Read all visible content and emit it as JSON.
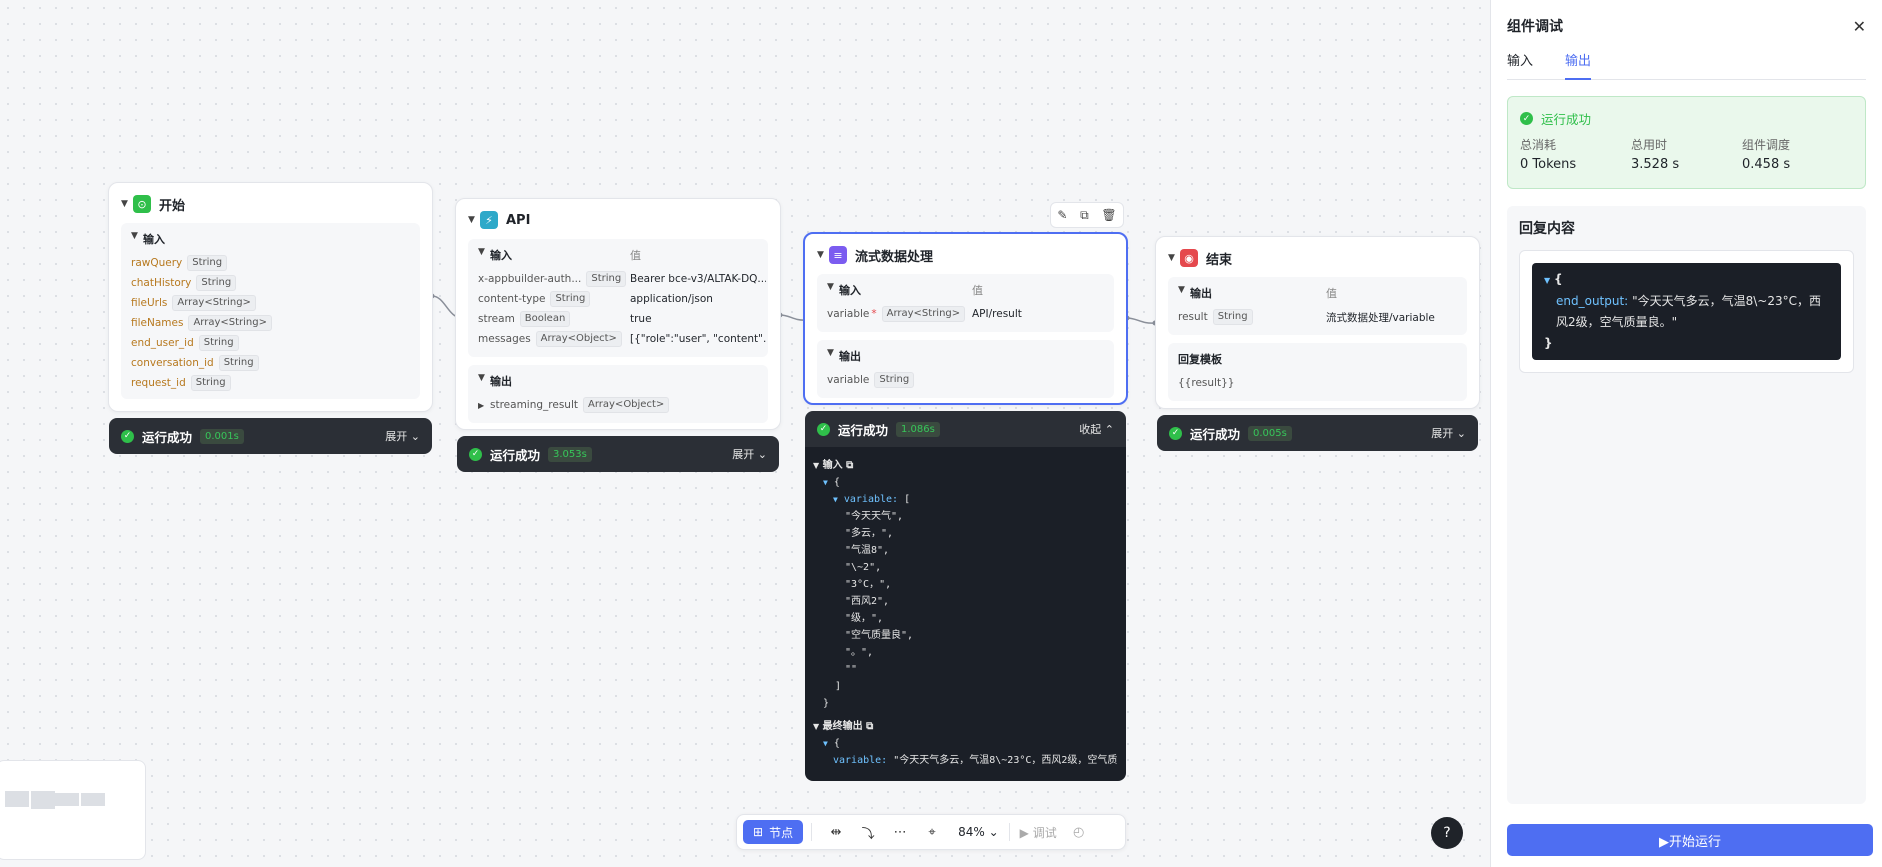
{
  "nodes": {
    "start": {
      "title": "开始",
      "input_label": "输入",
      "vars": [
        {
          "name": "rawQuery",
          "type": "String"
        },
        {
          "name": "chatHistory",
          "type": "String"
        },
        {
          "name": "fileUrls",
          "type": "Array<String>"
        },
        {
          "name": "fileNames",
          "type": "Array<String>"
        },
        {
          "name": "end_user_id",
          "type": "String"
        },
        {
          "name": "conversation_id",
          "type": "String"
        },
        {
          "name": "request_id",
          "type": "String"
        }
      ],
      "status": "运行成功",
      "time": "0.001s",
      "toggle": "展开"
    },
    "api": {
      "title": "API",
      "input_label": "输入",
      "value_label": "值",
      "rows": [
        {
          "name": "x-appbuilder-auth...",
          "type": "String",
          "value": "Bearer bce-v3/ALTAK-DQ..."
        },
        {
          "name": "content-type",
          "type": "String",
          "value": "application/json"
        },
        {
          "name": "stream",
          "type": "Boolean",
          "value": "true"
        },
        {
          "name": "messages",
          "type": "Array<Object>",
          "value": "[{\"role\":\"user\", \"content\"..."
        }
      ],
      "output_label": "输出",
      "output": {
        "name": "streaming_result",
        "type": "Array<Object>"
      },
      "status": "运行成功",
      "time": "3.053s",
      "toggle": "展开"
    },
    "stream": {
      "title": "流式数据处理",
      "input_label": "输入",
      "value_label": "值",
      "input_row": {
        "name": "variable",
        "required": "*",
        "type": "Array<String>",
        "value": "API/result"
      },
      "output_label": "输出",
      "output_row": {
        "name": "variable",
        "type": "String"
      },
      "status": "运行成功",
      "time": "1.086s",
      "toggle": "收起",
      "debug": {
        "input_label": "输入",
        "lines": [
          "\"今天天气\",",
          "\"多云，\",",
          "\"气温8\",",
          "\"\\~2\",",
          "\"3°C，\",",
          "\"西风2\",",
          "\"级，\",",
          "\"空气质量良\",",
          "\"。\",",
          "\"\""
        ],
        "open_brace": "{",
        "var_key": "variable:",
        "open_bracket": "[",
        "close_bracket": "]",
        "close_brace": "}",
        "final_label": "最终输出",
        "final_brace": "{",
        "final_key": "variable:",
        "final_value": "\"今天天气多云，气温8\\~23°C，西风2级，空气质"
      }
    },
    "end": {
      "title": "结束",
      "output_label": "输出",
      "value_label": "值",
      "row": {
        "name": "result",
        "type": "String",
        "value": "流式数据处理/variable"
      },
      "template_label": "回复模板",
      "template": "{{result}}",
      "status": "运行成功",
      "time": "0.005s",
      "toggle": "展开"
    }
  },
  "toolbar": {
    "node_label": "节点",
    "zoom": "84%",
    "debug_label": "调试"
  },
  "help": "?",
  "panel": {
    "title": "组件调试",
    "tabs": [
      {
        "label": "输入"
      },
      {
        "label": "输出"
      }
    ],
    "success": "运行成功",
    "stats": [
      {
        "label": "总消耗",
        "value": "0 Tokens"
      },
      {
        "label": "总用时",
        "value": "3.528 s"
      },
      {
        "label": "组件调度",
        "value": "0.458 s"
      }
    ],
    "reply_title": "回复内容",
    "reply_open": "{",
    "reply_key": "end_output:",
    "reply_value": "\"今天天气多云，气温8\\~23°C，西风2级，空气质量良。\"",
    "reply_close": "}",
    "run_button": "▶开始运行"
  },
  "colors": {
    "accent": "#4e6ef2",
    "success": "#2fbf4a",
    "dark": "#1b1f27"
  }
}
